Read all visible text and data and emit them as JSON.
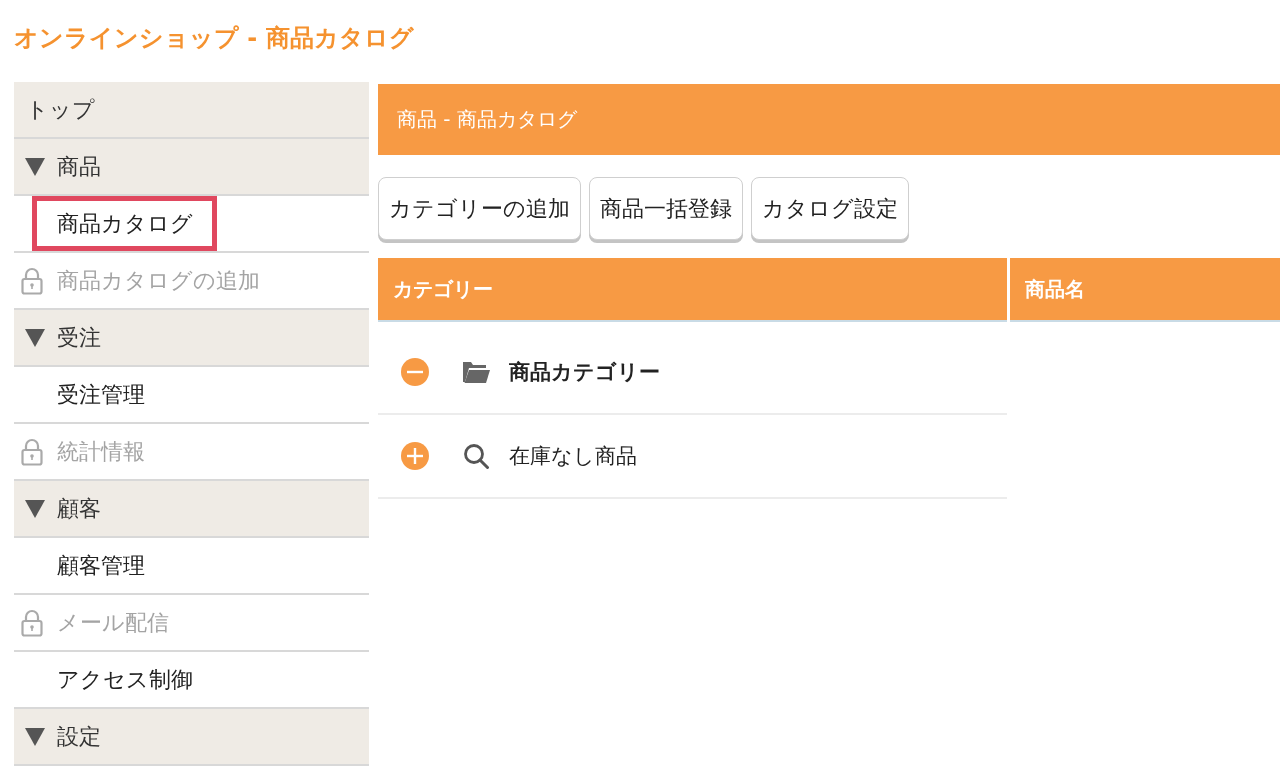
{
  "page_title": "オンラインショップ - 商品カタログ",
  "sidebar": {
    "items": [
      {
        "kind": "link",
        "label": "トップ"
      },
      {
        "kind": "group",
        "label": "商品",
        "expanded": true,
        "children": [
          {
            "label": "商品カタログ",
            "locked": false,
            "highlighted": true
          },
          {
            "label": "商品カタログの追加",
            "locked": true,
            "highlighted": false
          }
        ]
      },
      {
        "kind": "group",
        "label": "受注",
        "expanded": true,
        "children": [
          {
            "label": "受注管理",
            "locked": false,
            "highlighted": false
          },
          {
            "label": "統計情報",
            "locked": true,
            "highlighted": false
          }
        ]
      },
      {
        "kind": "group",
        "label": "顧客",
        "expanded": true,
        "children": [
          {
            "label": "顧客管理",
            "locked": false,
            "highlighted": false
          },
          {
            "label": "メール配信",
            "locked": true,
            "highlighted": false
          },
          {
            "label": "アクセス制御",
            "locked": false,
            "highlighted": false
          }
        ]
      },
      {
        "kind": "group",
        "label": "設定",
        "expanded": true
      }
    ]
  },
  "main": {
    "header": "商品 - 商品カタログ",
    "buttons": [
      "カテゴリーの追加",
      "商品一括登録",
      "カタログ設定"
    ],
    "table": {
      "columns": [
        "カテゴリー",
        "商品名"
      ],
      "rows": [
        {
          "kind": "folder",
          "label": "商品カテゴリー",
          "expanded": true,
          "selected": true
        },
        {
          "kind": "search",
          "label": "在庫なし商品",
          "expanded": false,
          "selected": false
        }
      ]
    }
  }
}
